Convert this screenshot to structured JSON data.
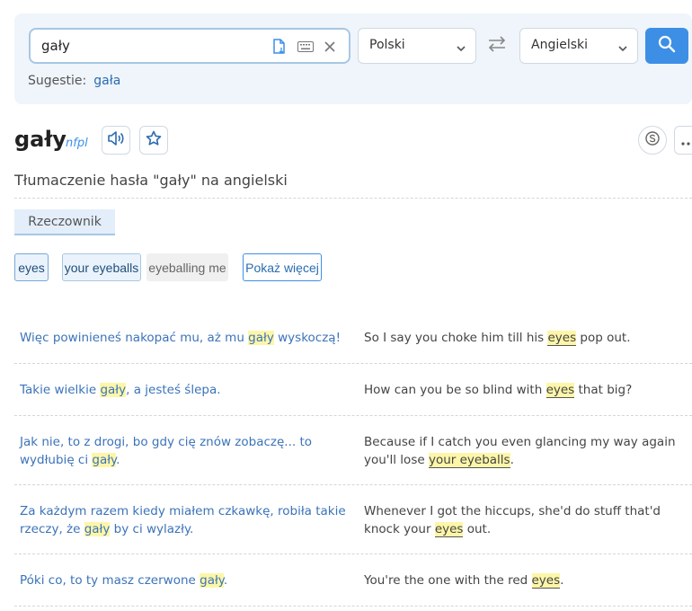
{
  "search": {
    "query": "gały",
    "source_language": "Polski",
    "target_language": "Angielski",
    "suggestions_label": "Sugestie:",
    "suggestion": "gała"
  },
  "entry": {
    "headword": "gały",
    "grammar": "nfpl",
    "heading": "Tłumaczenie hasła \"gały\" na angielski",
    "pos_tab": "Rzeczownik"
  },
  "translations": [
    "eyes",
    "your eyeballs",
    "eyeballing me"
  ],
  "show_more": "Pokaż więcej",
  "examples": [
    {
      "src_pre": "Więc powinieneś nakopać mu, aż mu ",
      "src_hl": "gały",
      "src_post": " wyskoczą!",
      "tgt_pre": "So I say you choke him till his ",
      "tgt_hl": "eyes",
      "tgt_post": " pop out."
    },
    {
      "src_pre": "Takie wielkie ",
      "src_hl": "gały",
      "src_post": ", a jesteś ślepa.",
      "tgt_pre": "How can you be so blind with ",
      "tgt_hl": "eyes",
      "tgt_post": " that big?"
    },
    {
      "src_pre": "Jak nie, to z drogi, bo gdy cię znów zobaczę... to wydłubię ci ",
      "src_hl": "gały",
      "src_post": ".",
      "tgt_pre": "Because if I catch you even glancing my way again you'll lose ",
      "tgt_hl": "your eyeballs",
      "tgt_post": "."
    },
    {
      "src_pre": "Za każdym razem kiedy miałem czkawkę, robiła takie rzeczy, że ",
      "src_hl": "gały",
      "src_post": " by ci wylazły.",
      "tgt_pre": "Whenever I got the hiccups, she'd do stuff that'd knock your ",
      "tgt_hl": "eyes",
      "tgt_post": " out."
    },
    {
      "src_pre": "Póki co, to ty masz czerwone ",
      "src_hl": "gały",
      "src_post": ".",
      "tgt_pre": "You're the one with the red ",
      "tgt_hl": "eyes",
      "tgt_post": "."
    }
  ],
  "icons": {
    "paste": "document-paste-icon",
    "keyboard": "keyboard-icon",
    "clear": "close-icon",
    "swap": "swap-arrows-icon",
    "search": "search-icon",
    "audio": "speaker-icon",
    "favorite": "star-icon",
    "skype": "skype-icon",
    "more": "more-horizontal-icon"
  },
  "colors": {
    "accent": "#3d8fe6",
    "highlight": "#fdf6a8",
    "panel": "#eff5fb"
  }
}
